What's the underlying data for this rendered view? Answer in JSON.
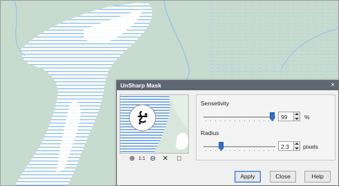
{
  "dialog": {
    "title": "UnSharp Mask",
    "close_glyph": "×"
  },
  "preview": {
    "image": "preview-thumbnail",
    "tools": [
      {
        "name": "zoom-in-icon",
        "glyph": "⊕"
      },
      {
        "name": "zoom-1to1-icon",
        "glyph": "1:1"
      },
      {
        "name": "zoom-out-icon",
        "glyph": "⊖"
      },
      {
        "name": "cross-icon",
        "glyph": "✕"
      },
      {
        "name": "fit-frame-icon",
        "glyph": "□"
      }
    ]
  },
  "sensitivity": {
    "label": "Sensetivity",
    "value": "99",
    "unit": "%",
    "slider_fraction": 0.99
  },
  "radius": {
    "label": "Radius",
    "value": "2.3",
    "unit": "pixels",
    "slider_fraction": 0.23
  },
  "buttons": {
    "apply": "Apply",
    "close": "Close",
    "help": "Help"
  },
  "colors": {
    "map_land": "#c7dccf",
    "map_water": "#ffffff",
    "map_hatch": "#8fc0e8",
    "titlebar": "#5d6672",
    "slider_thumb": "#2f6fd6"
  }
}
